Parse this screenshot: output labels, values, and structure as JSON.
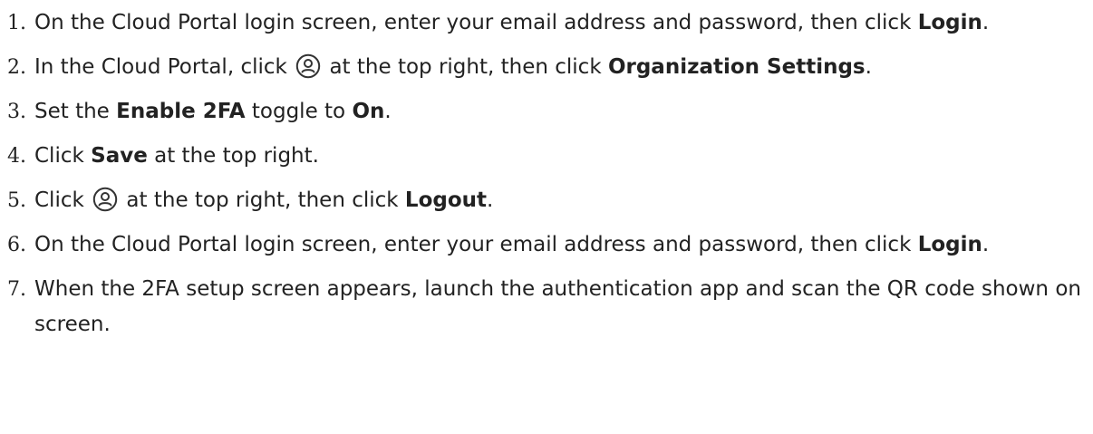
{
  "steps": [
    {
      "number": "1.",
      "before": "On the Cloud Portal login screen, enter your email address and password, then click ",
      "bold": "Login",
      "after": "."
    },
    {
      "number": "2.",
      "before": "In the Cloud Portal, click ",
      "icon": "user-account-icon",
      "middle": " at the top right, then click ",
      "bold": "Organization Settings",
      "after": "."
    },
    {
      "number": "3.",
      "before": "Set the ",
      "bold": "Enable 2FA",
      "middle": " toggle to ",
      "bold2": "On",
      "after": "."
    },
    {
      "number": "4.",
      "before": "Click ",
      "bold": "Save",
      "after": " at the top right."
    },
    {
      "number": "5.",
      "before": "Click ",
      "icon": "user-account-icon",
      "middle": " at the top right, then click ",
      "bold": "Logout",
      "after": "."
    },
    {
      "number": "6.",
      "before": "On the Cloud Portal login screen, enter your email address and password, then click ",
      "bold": "Login",
      "after": "."
    },
    {
      "number": "7.",
      "text": "When the 2FA setup screen appears, launch the authentication app and scan the QR code shown on screen."
    }
  ]
}
